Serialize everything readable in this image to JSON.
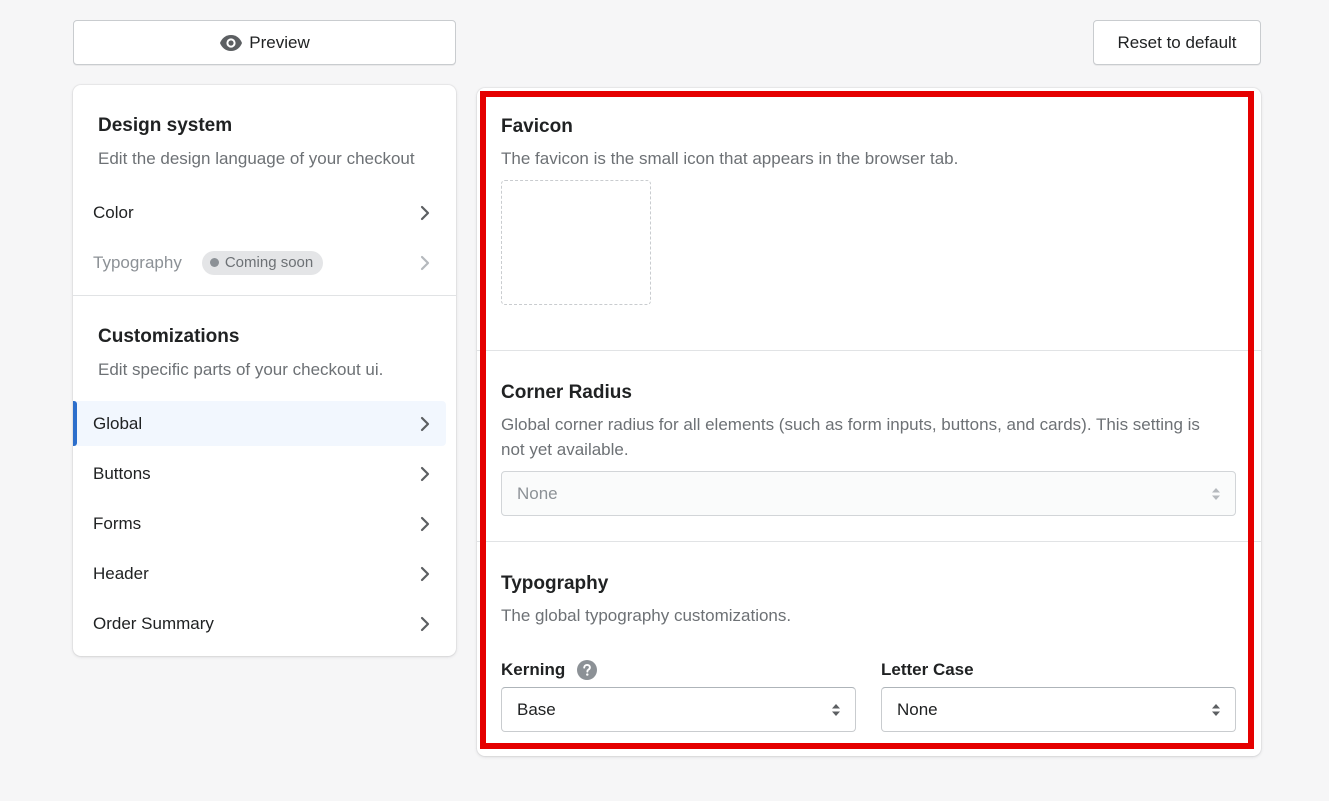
{
  "toolbar": {
    "preview_label": "Preview",
    "reset_label": "Reset to default"
  },
  "sidebar": {
    "design_system": {
      "title": "Design system",
      "description": "Edit the design language of your checkout",
      "items": [
        {
          "label": "Color"
        },
        {
          "label": "Typography",
          "badge": "Coming soon"
        }
      ]
    },
    "customizations": {
      "title": "Customizations",
      "description": "Edit specific parts of your checkout ui.",
      "items": [
        {
          "label": "Global",
          "active": true
        },
        {
          "label": "Buttons"
        },
        {
          "label": "Forms"
        },
        {
          "label": "Header"
        },
        {
          "label": "Order Summary"
        }
      ]
    }
  },
  "panel": {
    "favicon": {
      "title": "Favicon",
      "description": "The favicon is the small icon that appears in the browser tab."
    },
    "corner_radius": {
      "title": "Corner Radius",
      "description_line1": "Global corner radius for all elements (such as form inputs, buttons, and cards). This setting is",
      "description_line2": "not yet available.",
      "value": "None"
    },
    "typography": {
      "title": "Typography",
      "description": "The global typography customizations.",
      "kerning_label": "Kerning",
      "kerning_value": "Base",
      "letter_case_label": "Letter Case",
      "letter_case_value": "None"
    }
  },
  "colors": {
    "accent": "#2c6ecb",
    "highlight": "#e50000"
  }
}
